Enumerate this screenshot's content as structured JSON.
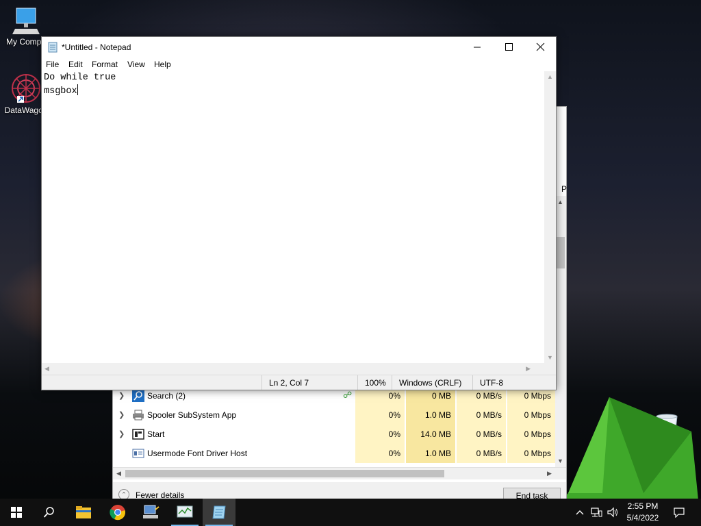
{
  "desktop": {
    "icons": [
      {
        "label": "My Compu"
      },
      {
        "label": "DataWagon"
      },
      {
        "label": "Recycle Bin"
      }
    ]
  },
  "notepad": {
    "title": "*Untitled - Notepad",
    "menu": [
      "File",
      "Edit",
      "Format",
      "View",
      "Help"
    ],
    "content_line1": "Do while true",
    "content_line2": "msgbox",
    "status": {
      "position": "Ln 2, Col 7",
      "zoom": "100%",
      "line_ending": "Windows (CRLF)",
      "encoding": "UTF-8"
    }
  },
  "task_manager": {
    "header_fragment": "P",
    "rows": [
      {
        "name": "Search (2)",
        "cpu": "0%",
        "memory": "0 MB",
        "disk": "0 MB/s",
        "network": "0 Mbps",
        "icon": "search-icon"
      },
      {
        "name": "Spooler SubSystem App",
        "cpu": "0%",
        "memory": "1.0 MB",
        "disk": "0 MB/s",
        "network": "0 Mbps",
        "icon": "printer-icon"
      },
      {
        "name": "Start",
        "cpu": "0%",
        "memory": "14.0 MB",
        "disk": "0 MB/s",
        "network": "0 Mbps",
        "icon": "start-app-icon"
      },
      {
        "name": "Usermode Font Driver Host",
        "cpu": "0%",
        "memory": "1.0 MB",
        "disk": "0 MB/s",
        "network": "0 Mbps",
        "icon": "font-host-icon"
      }
    ],
    "fewer_details": "Fewer details",
    "end_task": "End task"
  },
  "taskbar": {
    "time": "2:55 PM",
    "date": "5/4/2022",
    "accent": "#76b9ed"
  }
}
